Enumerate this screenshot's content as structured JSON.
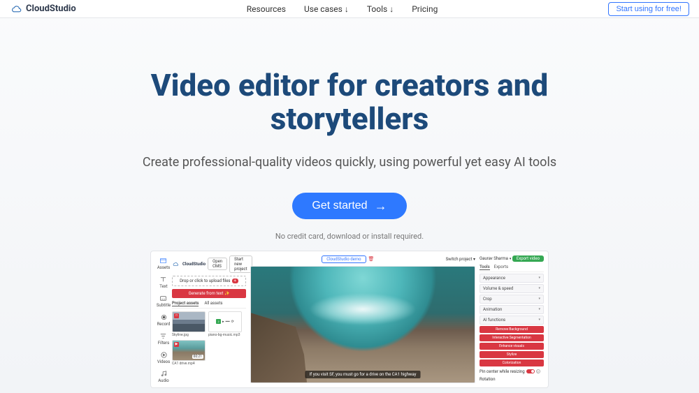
{
  "brand": "CloudStudio",
  "nav": {
    "resources": "Resources",
    "usecases": "Use cases ↓",
    "tools": "Tools ↓",
    "pricing": "Pricing",
    "cta": "Start using for free!"
  },
  "hero": {
    "title_line1": "Video editor for creators and",
    "title_line2": "storytellers",
    "subtitle": "Create professional-quality videos quickly, using powerful yet easy AI tools",
    "cta": "Get started",
    "note": "No credit card, download or install required."
  },
  "preview": {
    "iconcol": [
      "Assets",
      "Text",
      "Subtitle",
      "Record",
      "Filters",
      "Videos",
      "Audio"
    ],
    "buttons": {
      "open_cms": "Open CMS",
      "start_new": "Start new project",
      "upload": "Drop or click to upload files",
      "generate": "Generate from text ✨",
      "demo": "CloudStudio demo",
      "switch": "Switch project ▾",
      "user": "Gaurav Sharma",
      "export": "Export video"
    },
    "asset_tabs": {
      "a": "Project assets",
      "b": "All assets"
    },
    "thumbs": {
      "t1": "Skyline.jpg",
      "t2": "piano-bg-music.mp3",
      "t3": "CA1 drive.mp4",
      "dur": "00:21"
    },
    "subtitle_text": "If you visit SF, you must go for a drive on the CA1 highway",
    "right": {
      "tabs": {
        "a": "Tools",
        "b": "Exports"
      },
      "acc": [
        "Appearance",
        "Volume & speed",
        "Crop",
        "Animation",
        "AI functions"
      ],
      "ai": [
        "Remove Background",
        "Interactive Segmentation",
        "Enhance visuals",
        "Stylize",
        "Colorization"
      ],
      "pin": "Pin center while resizing",
      "rot": "Rotation"
    }
  }
}
